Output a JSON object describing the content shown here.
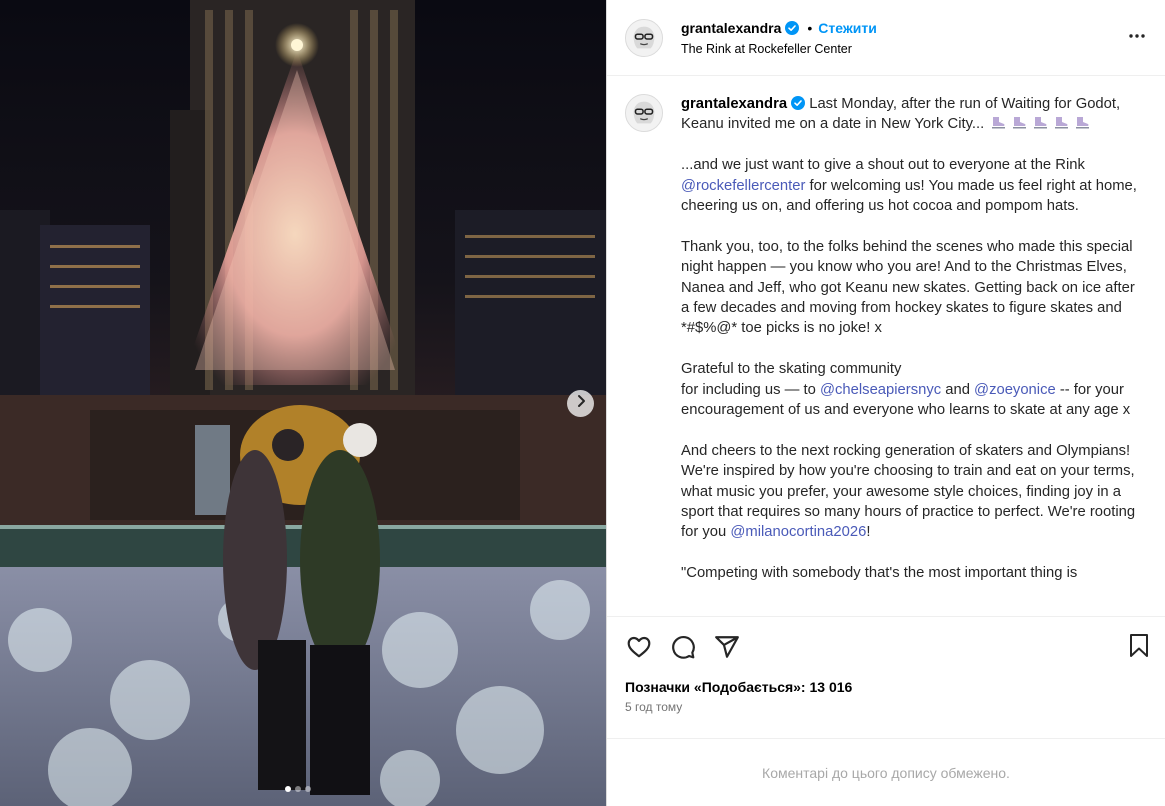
{
  "post": {
    "username": "grantalexandra",
    "follow_label": "Стежити",
    "separator": "•",
    "location": "The Rink at Rockefeller Center"
  },
  "caption": {
    "username": "grantalexandra",
    "p1_text": "Last Monday, after the run of Waiting for Godot, Keanu invited me on a date in New York City...",
    "p2_a": "...and we just want to give a shout out to everyone at the Rink ",
    "p2_mention": "@rockefellercenter",
    "p2_b": " for welcoming us! You made us feel right at home, cheering us on, and offering us hot cocoa and pompom hats.",
    "p3": "Thank you, too, to the folks behind the scenes who made this special night happen — you know who you are! And to the Christmas Elves, Nanea and Jeff, who got Keanu new skates. Getting back on ice after a few decades and moving from hockey skates to figure skates and *#$%@* toe picks is no joke! x",
    "p4_a": "Grateful to the skating community",
    "p4_b": "for including us — to ",
    "p4_mention1": "@chelseapiersnyc",
    "p4_and": " and ",
    "p4_mention2": "@zoeyonice",
    "p4_c": " -- for your encouragement of us and everyone who learns to skate at any age x",
    "p5_a": "And cheers to the next rocking generation of skaters and Olympians! We're inspired by how you're choosing to train and eat on your terms, what music you prefer, your awesome style choices, finding joy in a sport that requires so many hours of practice to perfect. We're rooting for you ",
    "p5_mention": "@milanocortina2026",
    "p5_b": "!",
    "p6": "\"Competing with somebody that's the most important thing is"
  },
  "likes_text": "Позначки «Подобається»: 13 016",
  "time_text": "5 год тому",
  "comments_disabled": "Коментарі до цього допису обмежено.",
  "carousel": {
    "count": 3,
    "active": 1
  },
  "icons": [
    "verified-badge-icon",
    "more-options-icon",
    "heart-icon",
    "comment-icon",
    "share-icon",
    "bookmark-icon",
    "chevron-right-icon",
    "ice-skate-emoji"
  ],
  "colors": {
    "accent": "#0095f6",
    "mention": "#4a5ab8",
    "border": "#dbdbdb",
    "muted": "#737373"
  }
}
